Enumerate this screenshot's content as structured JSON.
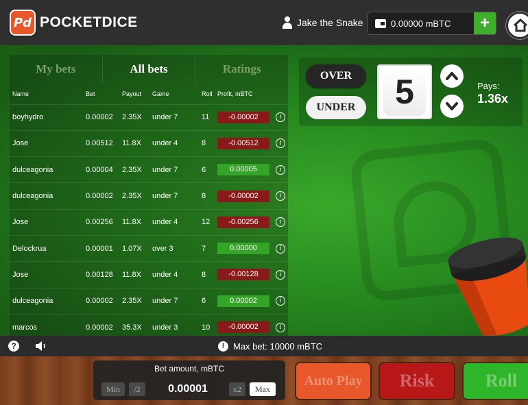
{
  "header": {
    "logo_mark": "Pd",
    "logo_text": "POCKETDICE",
    "username": "Jake the Snake",
    "balance": "0.00000 mBTC",
    "add_label": "+"
  },
  "tabs": [
    {
      "label": "My bets",
      "active": false
    },
    {
      "label": "All bets",
      "active": true
    },
    {
      "label": "Ratings",
      "active": false
    }
  ],
  "table": {
    "columns": [
      "Name",
      "Bet",
      "Payout",
      "Game",
      "Roll",
      "Profit, mBTC"
    ],
    "rows": [
      {
        "name": "boyhydro",
        "bet": "0.00002",
        "payout": "2.35X",
        "game": "under 7",
        "roll": "11",
        "profit": "-0.00002",
        "positive": false
      },
      {
        "name": "Jose",
        "bet": "0.00512",
        "payout": "11.8X",
        "game": "under 4",
        "roll": "8",
        "profit": "-0.00512",
        "positive": false
      },
      {
        "name": "dulceagonia",
        "bet": "0.00004",
        "payout": "2.35X",
        "game": "under 7",
        "roll": "6",
        "profit": "0.00005",
        "positive": true
      },
      {
        "name": "dulceagonia",
        "bet": "0.00002",
        "payout": "2.35X",
        "game": "under 7",
        "roll": "8",
        "profit": "-0.00002",
        "positive": false
      },
      {
        "name": "Jose",
        "bet": "0.00256",
        "payout": "11.8X",
        "game": "under 4",
        "roll": "12",
        "profit": "-0.00256",
        "positive": false
      },
      {
        "name": "Delockrua",
        "bet": "0.00001",
        "payout": "1.07X",
        "game": "over 3",
        "roll": "7",
        "profit": "0.00000",
        "positive": true
      },
      {
        "name": "Jose",
        "bet": "0.00128",
        "payout": "11.8X",
        "game": "under 4",
        "roll": "8",
        "profit": "-0.00128",
        "positive": false
      },
      {
        "name": "dulceagonia",
        "bet": "0.00002",
        "payout": "2.35X",
        "game": "under 7",
        "roll": "6",
        "profit": "0.00002",
        "positive": true
      },
      {
        "name": "marcos",
        "bet": "0.00002",
        "payout": "35.3X",
        "game": "under 3",
        "roll": "10",
        "profit": "-0.00002",
        "positive": false
      }
    ]
  },
  "controls": {
    "over_label": "OVER",
    "under_label": "UNDER",
    "target_number": "5",
    "pays_label": "Pays:",
    "pays_value": "1.36x"
  },
  "status": {
    "help": "?",
    "max_bet": "Max bet: 10000 mBTC"
  },
  "bet": {
    "label": "Bet amount, mBTC",
    "min_label": "Min",
    "half_label": "/2",
    "amount": "0.00001",
    "double_label": "x2",
    "max_label": "Max"
  },
  "actions": {
    "auto_play": "Auto Play",
    "risk": "Risk",
    "roll": "Roll"
  },
  "colors": {
    "accent_orange": "#e8582a",
    "loss_red": "#8a1a1a",
    "win_green": "#35a52a"
  }
}
